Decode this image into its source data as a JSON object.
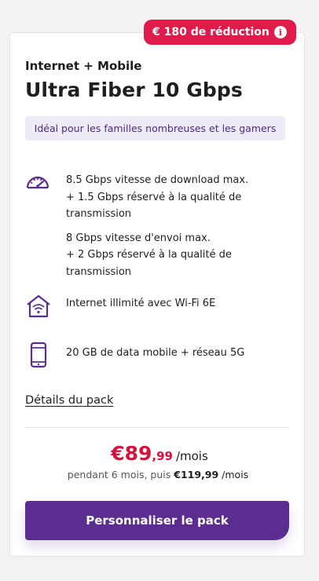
{
  "promo": {
    "label": "€ 180 de réduction",
    "info_icon": "info-icon"
  },
  "plan": {
    "category": "Internet + Mobile",
    "title": "Ultra Fiber 10 Gbps",
    "tag": "Idéal pour les familles nombreuses et les gamers"
  },
  "features": {
    "speed": {
      "icon": "speedometer-icon",
      "download_lines": [
        "8.5 Gbps vitesse de download max.",
        "+ 1.5 Gbps réservé à la qualité de",
        "transmission"
      ],
      "upload_lines": [
        "8 Gbps vitesse d'envoi max.",
        "+ 2 Gbps réservé à la qualité de",
        "transmission"
      ]
    },
    "wifi": {
      "icon": "wifi-home-icon",
      "text": "Internet illimité avec Wi-Fi 6E"
    },
    "mobile": {
      "icon": "smartphone-icon",
      "text": "20 GB de data mobile + réseau 5G"
    }
  },
  "details_link": "Détails du pack",
  "price": {
    "main": "€89",
    "cents": ",99",
    "unit": "/mois",
    "after_prefix": "pendant 6 mois, puis",
    "after_price": "€119,99",
    "after_unit": "/mois"
  },
  "cta_label": "Personnaliser le pack",
  "colors": {
    "accent": "#5b2d90",
    "promo": "#e01b4a",
    "price": "#d6103f",
    "tag_bg": "#efebf6"
  }
}
